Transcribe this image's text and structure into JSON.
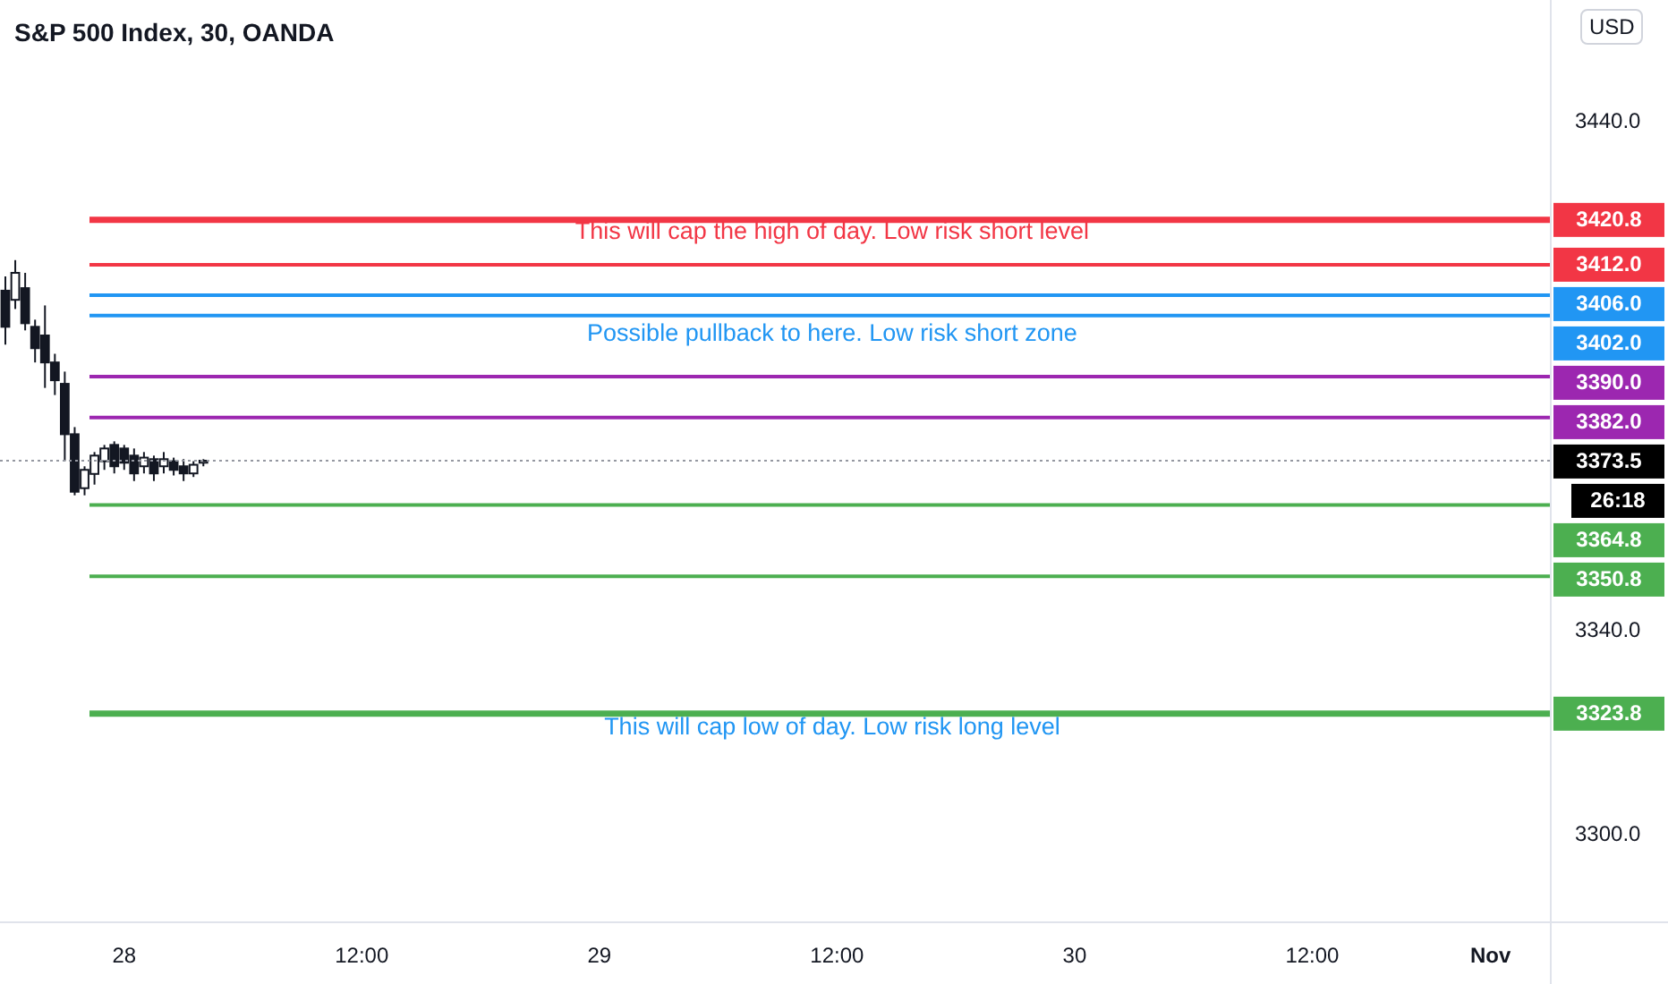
{
  "header": {
    "title": "S&P 500 Index, 30, OANDA",
    "currency": "USD"
  },
  "chart": {
    "chart_data": {
      "type": "candlestick",
      "ylim": [
        3283,
        3464
      ],
      "categories": [
        null,
        null,
        null,
        null,
        null,
        null,
        null,
        null,
        null,
        null,
        null,
        null,
        "28",
        null,
        null,
        null,
        null,
        null,
        null,
        null,
        null,
        null,
        null,
        null,
        null,
        null,
        null,
        null,
        null,
        null,
        null,
        null,
        null,
        null,
        null,
        null,
        "12:00",
        null,
        null,
        null,
        null,
        null,
        null,
        null,
        null,
        null,
        null,
        null,
        null,
        null,
        null,
        null,
        null,
        null,
        null,
        null,
        null,
        null,
        null,
        null,
        "29",
        null,
        null,
        null,
        null,
        null,
        null,
        null,
        null,
        null,
        null,
        null,
        null,
        null,
        null,
        null,
        null,
        null,
        null,
        null,
        null,
        null,
        null,
        null,
        "12:00",
        null,
        null,
        null,
        null,
        null,
        null,
        null,
        null,
        null,
        null,
        null,
        null,
        null,
        null,
        null,
        null,
        null,
        null,
        null,
        null,
        null,
        null,
        null,
        "30",
        null,
        null,
        null,
        null,
        null,
        null,
        null,
        null,
        null,
        null,
        null,
        null,
        null,
        null,
        null,
        null,
        null,
        null,
        null,
        null,
        null,
        null,
        null,
        "12:00",
        null,
        null,
        null,
        null,
        null,
        null,
        null,
        null,
        null,
        null,
        null,
        null,
        null,
        null,
        null,
        null,
        null,
        "Nov",
        null,
        null,
        null,
        null,
        null
      ],
      "yticks": [
        {
          "value": 3440,
          "label": "3440.0"
        },
        {
          "value": 3340,
          "label": "3340.0"
        },
        {
          "value": 3300,
          "label": "3300.0"
        }
      ],
      "ohlc": [
        [
          3406.9,
          3409.7,
          3396.3,
          3399.8
        ],
        [
          3405.1,
          3412.9,
          3403.3,
          3410.4
        ],
        [
          3407.4,
          3410.4,
          3399.1,
          3400.5
        ],
        [
          3399.8,
          3401.2,
          3392.8,
          3395.6
        ],
        [
          3398.1,
          3404.0,
          3387.8,
          3392.8
        ],
        [
          3392.8,
          3394.5,
          3386.4,
          3389.3
        ],
        [
          3388.6,
          3391.0,
          3373.4,
          3378.7
        ],
        [
          3378.7,
          3380.1,
          3366.7,
          3367.4
        ],
        [
          3368.1,
          3372.4,
          3366.7,
          3371.7
        ],
        [
          3370.9,
          3375.2,
          3368.8,
          3374.5
        ],
        [
          3373.4,
          3376.6,
          3371.7,
          3375.9
        ],
        [
          3376.6,
          3377.3,
          3371.0,
          3372.4
        ],
        [
          3375.9,
          3376.6,
          3371.7,
          3373.1
        ],
        [
          3374.5,
          3375.9,
          3369.5,
          3371.0
        ],
        [
          3372.4,
          3375.2,
          3371.0,
          3374.1
        ],
        [
          3373.8,
          3374.5,
          3369.5,
          3371.0
        ],
        [
          3372.4,
          3375.2,
          3371.0,
          3373.8
        ],
        [
          3373.4,
          3374.1,
          3370.6,
          3371.7
        ],
        [
          3372.4,
          3373.8,
          3369.5,
          3371.0
        ],
        [
          3371.0,
          3373.4,
          3370.3,
          3372.7
        ],
        [
          3373.1,
          3373.8,
          3372.4,
          3373.5
        ],
        null,
        null,
        null,
        null,
        null,
        null,
        null,
        null,
        null,
        null,
        null,
        null,
        null,
        null,
        null,
        null,
        null,
        null,
        null,
        null,
        null,
        null,
        null,
        null,
        null,
        null,
        null,
        null,
        null,
        null,
        null,
        null,
        null,
        null,
        null,
        null,
        null,
        null,
        null,
        null,
        null,
        null,
        null,
        null,
        null,
        null,
        null,
        null,
        null,
        null,
        null,
        null,
        null,
        null,
        null,
        null,
        null,
        null,
        null,
        null,
        null,
        null,
        null,
        null,
        null,
        null,
        null,
        null,
        null,
        null,
        null,
        null,
        null,
        null,
        null,
        null,
        null,
        null,
        null,
        null,
        null,
        null,
        null,
        null,
        null,
        null,
        null,
        null,
        null,
        null,
        null,
        null,
        null,
        null,
        null,
        null,
        null,
        null,
        null,
        null,
        null,
        null,
        null,
        null,
        null,
        null,
        null,
        null,
        null,
        null,
        null,
        null,
        null,
        null,
        null,
        null,
        null,
        null,
        null,
        null,
        null,
        null,
        null,
        null,
        null,
        null,
        null,
        null,
        null,
        null,
        null,
        null,
        null,
        null,
        null
      ],
      "ref_lines": [
        {
          "axis": "y",
          "value": 3420.8,
          "label": "3420.8",
          "color": "#f23645"
        },
        {
          "axis": "y",
          "value": 3412.0,
          "label": "3412.0",
          "color": "#f23645"
        },
        {
          "axis": "y",
          "value": 3406.0,
          "label": "3406.0",
          "color": "#2196f3"
        },
        {
          "axis": "y",
          "value": 3402.0,
          "label": "3402.0",
          "color": "#2196f3"
        },
        {
          "axis": "y",
          "value": 3390.0,
          "label": "3390.0",
          "color": "#9c27b0"
        },
        {
          "axis": "y",
          "value": 3382.0,
          "label": "3382.0",
          "color": "#9c27b0"
        },
        {
          "axis": "y",
          "value": 3373.5,
          "label": "3373.5",
          "color": "#9598a1"
        },
        {
          "axis": "y",
          "value": 3364.8,
          "label": "3364.8",
          "color": "#4caf50"
        },
        {
          "axis": "y",
          "value": 3350.8,
          "label": "3350.8",
          "color": "#4caf50"
        },
        {
          "axis": "y",
          "value": 3323.8,
          "label": "3323.8",
          "color": "#4caf50"
        }
      ]
    },
    "countdown": "26:18",
    "notes": [
      {
        "text": "This will cap the high of day. Low risk short level",
        "color": "#f23645"
      },
      {
        "text": "Possible pullback to here. Low risk short zone",
        "color": "#2196f3"
      },
      {
        "text": "This will cap low of day. Low risk long level",
        "color": "#2196f3"
      }
    ]
  }
}
